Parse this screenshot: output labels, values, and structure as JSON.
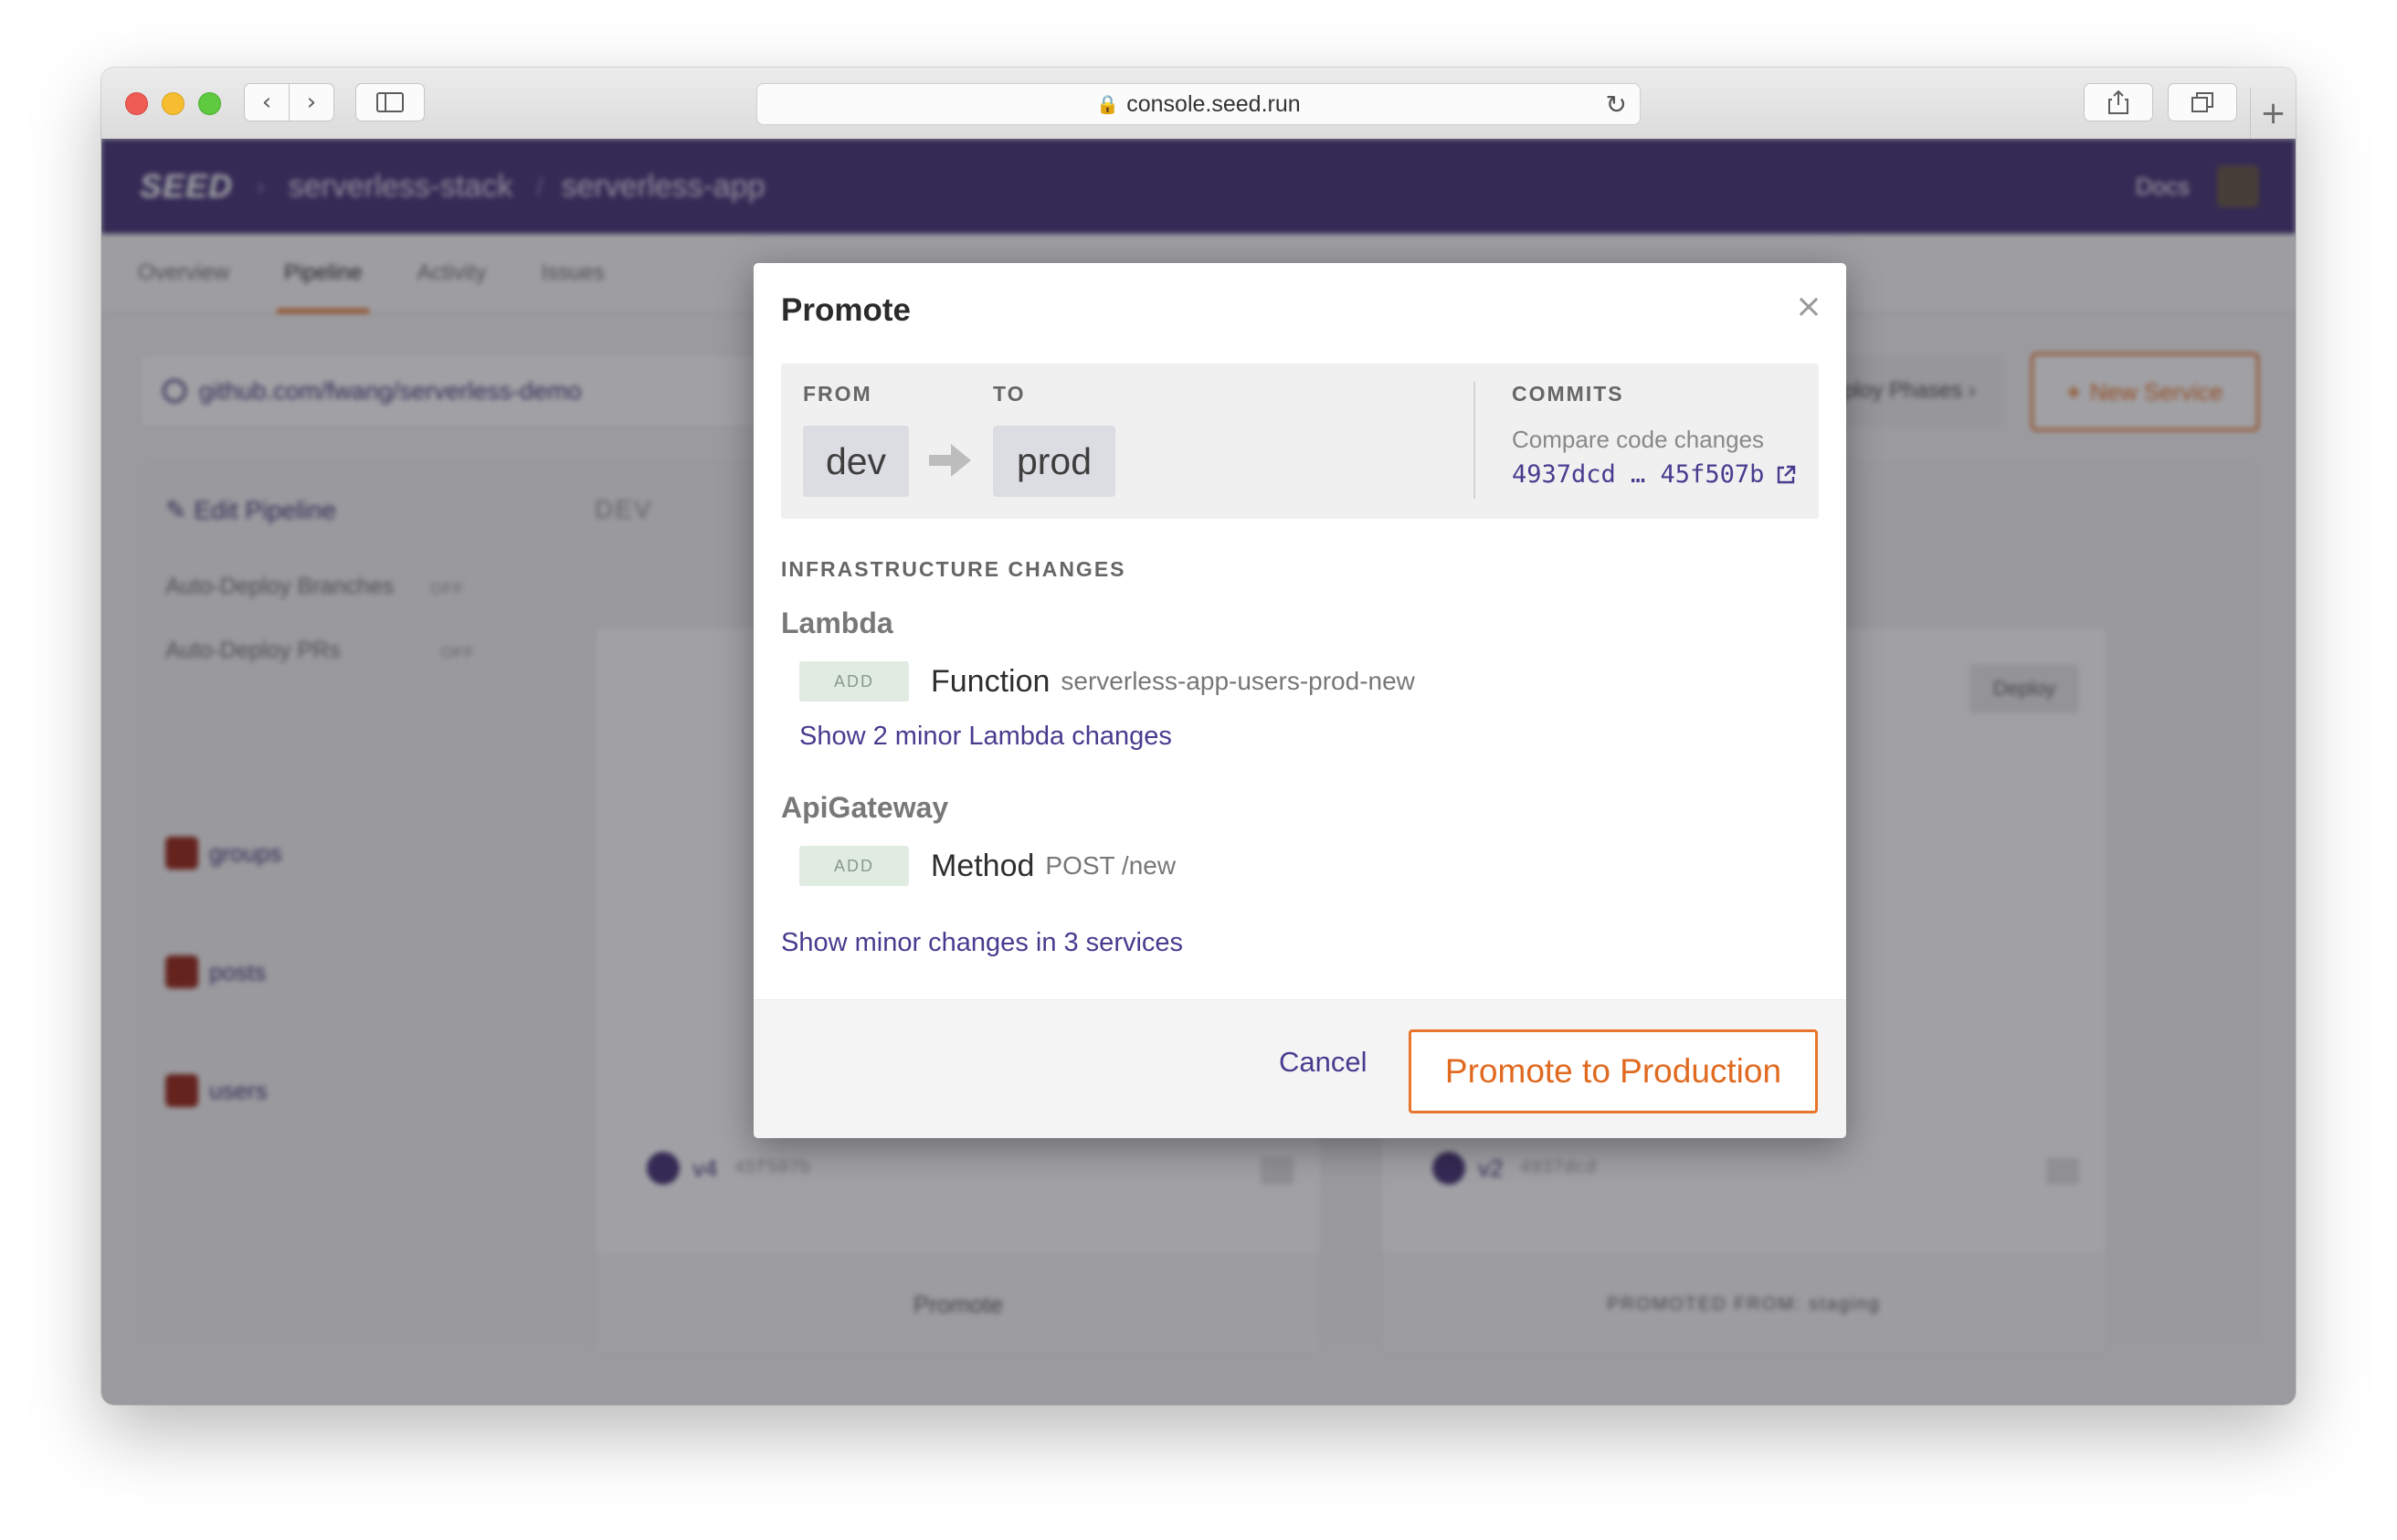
{
  "browser": {
    "url": "console.seed.run"
  },
  "app": {
    "logo": "SEED",
    "org": "serverless-stack",
    "app_name": "serverless-app",
    "docs": "Docs",
    "tabs": [
      "Overview",
      "Pipeline",
      "Activity",
      "Issues"
    ],
    "repo": "github.com/fwang/serverless-demo",
    "manage_phases": "Manage Deploy Phases ›",
    "new_service": "New Service",
    "edit_pipeline": "Edit Pipeline",
    "auto_deploy_branches": "Auto-Deploy Branches",
    "auto_deploy_prs": "Auto-Deploy PRs",
    "off": "OFF",
    "stage_label": "DEV",
    "services": [
      "groups",
      "posts",
      "users"
    ],
    "dev_card": {
      "version": "v4",
      "sha": "45f507b",
      "bottom": "Promote"
    },
    "prod_card": {
      "deploy": "Deploy",
      "version": "v2",
      "sha": "4937dcd",
      "bottom": "PROMOTED FROM: staging"
    }
  },
  "modal": {
    "title": "Promote",
    "from_label": "FROM",
    "to_label": "TO",
    "from_env": "dev",
    "to_env": "prod",
    "commits_label": "COMMITS",
    "compare_label": "Compare code changes",
    "commit_range": "4937dcd … 45f507b",
    "infra_title": "INFRASTRUCTURE CHANGES",
    "groups": [
      {
        "service": "Lambda",
        "changes": [
          {
            "badge": "ADD",
            "type": "Function",
            "name": "serverless-app-users-prod-new"
          }
        ],
        "minor_link": "Show 2 minor Lambda changes"
      },
      {
        "service": "ApiGateway",
        "changes": [
          {
            "badge": "ADD",
            "type": "Method",
            "name": "POST /new"
          }
        ]
      }
    ],
    "minor_services_link": "Show minor changes in 3 services",
    "cancel": "Cancel",
    "promote_button": "Promote to Production"
  },
  "colors": {
    "accent_orange": "#e8752b",
    "brand_purple": "#4a3a7a",
    "link_purple": "#4a3a8f"
  }
}
